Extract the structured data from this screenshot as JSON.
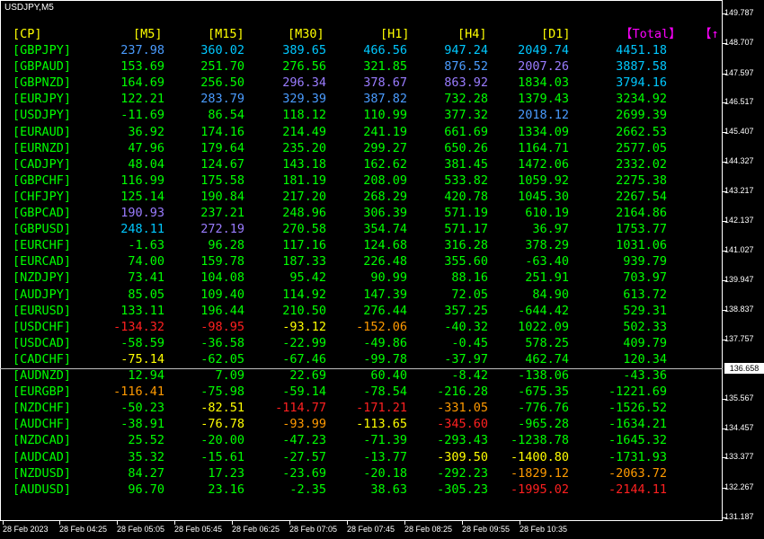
{
  "window": {
    "title": "USDJPY,M5"
  },
  "colors": {
    "pair": "#00ff00",
    "header": "#ffff00",
    "total_header": "#ff00ff",
    "c": "#00c8ff",
    "b": "#4a9cff",
    "m": "#9a7cff",
    "g": "#00ff00",
    "y": "#ffff00",
    "o": "#ff9a00",
    "r": "#ff2020"
  },
  "table": {
    "headers": [
      "[CP]",
      "[M5]",
      "[M15]",
      "[M30]",
      "[H1]",
      "[H4]",
      "[D1]",
      "【Total】",
      "【↑"
    ],
    "rows": [
      {
        "pair": "[GBPJPY]",
        "vals": [
          "237.98",
          "360.02",
          "389.65",
          "466.56",
          "947.24",
          "2049.74",
          "4451.18"
        ],
        "cols": [
          "b",
          "c",
          "c",
          "c",
          "c",
          "c",
          "c"
        ]
      },
      {
        "pair": "[GBPAUD]",
        "vals": [
          "153.69",
          "251.70",
          "276.56",
          "321.85",
          "876.52",
          "2007.26",
          "3887.58"
        ],
        "cols": [
          "g",
          "g",
          "g",
          "g",
          "b",
          "m",
          "c"
        ]
      },
      {
        "pair": "[GBPNZD]",
        "vals": [
          "164.69",
          "256.50",
          "296.34",
          "378.67",
          "863.92",
          "1834.03",
          "3794.16"
        ],
        "cols": [
          "g",
          "g",
          "m",
          "m",
          "m",
          "g",
          "c"
        ]
      },
      {
        "pair": "[EURJPY]",
        "vals": [
          "122.21",
          "283.79",
          "329.39",
          "387.82",
          "732.28",
          "1379.43",
          "3234.92"
        ],
        "cols": [
          "g",
          "b",
          "b",
          "b",
          "g",
          "g",
          "g"
        ]
      },
      {
        "pair": "[USDJPY]",
        "vals": [
          "-11.69",
          "86.54",
          "118.12",
          "110.99",
          "377.32",
          "2018.12",
          "2699.39"
        ],
        "cols": [
          "g",
          "g",
          "g",
          "g",
          "g",
          "b",
          "g"
        ]
      },
      {
        "pair": "[EURAUD]",
        "vals": [
          "36.92",
          "174.16",
          "214.49",
          "241.19",
          "661.69",
          "1334.09",
          "2662.53"
        ],
        "cols": [
          "g",
          "g",
          "g",
          "g",
          "g",
          "g",
          "g"
        ]
      },
      {
        "pair": "[EURNZD]",
        "vals": [
          "47.96",
          "179.64",
          "235.20",
          "299.27",
          "650.26",
          "1164.71",
          "2577.05"
        ],
        "cols": [
          "g",
          "g",
          "g",
          "g",
          "g",
          "g",
          "g"
        ]
      },
      {
        "pair": "[CADJPY]",
        "vals": [
          "48.04",
          "124.67",
          "143.18",
          "162.62",
          "381.45",
          "1472.06",
          "2332.02"
        ],
        "cols": [
          "g",
          "g",
          "g",
          "g",
          "g",
          "g",
          "g"
        ]
      },
      {
        "pair": "[GBPCHF]",
        "vals": [
          "116.99",
          "175.58",
          "181.19",
          "208.09",
          "533.82",
          "1059.92",
          "2275.38"
        ],
        "cols": [
          "g",
          "g",
          "g",
          "g",
          "g",
          "g",
          "g"
        ]
      },
      {
        "pair": "[CHFJPY]",
        "vals": [
          "125.14",
          "190.84",
          "217.20",
          "268.29",
          "420.78",
          "1045.30",
          "2267.54"
        ],
        "cols": [
          "g",
          "g",
          "g",
          "g",
          "g",
          "g",
          "g"
        ]
      },
      {
        "pair": "[GBPCAD]",
        "vals": [
          "190.93",
          "237.21",
          "248.96",
          "306.39",
          "571.19",
          "610.19",
          "2164.86"
        ],
        "cols": [
          "m",
          "g",
          "g",
          "g",
          "g",
          "g",
          "g"
        ]
      },
      {
        "pair": "[GBPUSD]",
        "vals": [
          "248.11",
          "272.19",
          "270.58",
          "354.74",
          "571.17",
          "36.97",
          "1753.77"
        ],
        "cols": [
          "c",
          "m",
          "g",
          "g",
          "g",
          "g",
          "g"
        ]
      },
      {
        "pair": "[EURCHF]",
        "vals": [
          "-1.63",
          "96.28",
          "117.16",
          "124.68",
          "316.28",
          "378.29",
          "1031.06"
        ],
        "cols": [
          "g",
          "g",
          "g",
          "g",
          "g",
          "g",
          "g"
        ]
      },
      {
        "pair": "[EURCAD]",
        "vals": [
          "74.00",
          "159.78",
          "187.33",
          "226.48",
          "355.60",
          "-63.40",
          "939.79"
        ],
        "cols": [
          "g",
          "g",
          "g",
          "g",
          "g",
          "g",
          "g"
        ]
      },
      {
        "pair": "[NZDJPY]",
        "vals": [
          "73.41",
          "104.08",
          "95.42",
          "90.99",
          "88.16",
          "251.91",
          "703.97"
        ],
        "cols": [
          "g",
          "g",
          "g",
          "g",
          "g",
          "g",
          "g"
        ]
      },
      {
        "pair": "[AUDJPY]",
        "vals": [
          "85.05",
          "109.40",
          "114.92",
          "147.39",
          "72.05",
          "84.90",
          "613.72"
        ],
        "cols": [
          "g",
          "g",
          "g",
          "g",
          "g",
          "g",
          "g"
        ]
      },
      {
        "pair": "[EURUSD]",
        "vals": [
          "133.11",
          "196.44",
          "210.50",
          "276.44",
          "357.25",
          "-644.42",
          "529.31"
        ],
        "cols": [
          "g",
          "g",
          "g",
          "g",
          "g",
          "g",
          "g"
        ]
      },
      {
        "pair": "[USDCHF]",
        "vals": [
          "-134.32",
          "-98.95",
          "-93.12",
          "-152.06",
          "-40.32",
          "1022.09",
          "502.33"
        ],
        "cols": [
          "r",
          "r",
          "y",
          "o",
          "g",
          "g",
          "g"
        ]
      },
      {
        "pair": "[USDCAD]",
        "vals": [
          "-58.59",
          "-36.58",
          "-22.99",
          "-49.86",
          "-0.45",
          "578.25",
          "409.79"
        ],
        "cols": [
          "g",
          "g",
          "g",
          "g",
          "g",
          "g",
          "g"
        ]
      },
      {
        "pair": "[CADCHF]",
        "vals": [
          "-75.14",
          "-62.05",
          "-67.46",
          "-99.78",
          "-37.97",
          "462.74",
          "120.34"
        ],
        "cols": [
          "y",
          "g",
          "g",
          "g",
          "g",
          "g",
          "g"
        ]
      },
      {
        "pair": "[AUDNZD]",
        "vals": [
          "12.94",
          "7.09",
          "22.69",
          "60.40",
          "-8.42",
          "-138.06",
          "-43.36"
        ],
        "cols": [
          "g",
          "g",
          "g",
          "g",
          "g",
          "g",
          "g"
        ]
      },
      {
        "pair": "[EURGBP]",
        "vals": [
          "-116.41",
          "-75.98",
          "-59.14",
          "-78.54",
          "-216.28",
          "-675.35",
          "-1221.69"
        ],
        "cols": [
          "o",
          "g",
          "g",
          "g",
          "g",
          "g",
          "g"
        ]
      },
      {
        "pair": "[NZDCHF]",
        "vals": [
          "-50.23",
          "-82.51",
          "-114.77",
          "-171.21",
          "-331.05",
          "-776.76",
          "-1526.52"
        ],
        "cols": [
          "g",
          "y",
          "r",
          "r",
          "o",
          "g",
          "g"
        ]
      },
      {
        "pair": "[AUDCHF]",
        "vals": [
          "-38.91",
          "-76.78",
          "-93.99",
          "-113.65",
          "-345.60",
          "-965.28",
          "-1634.21"
        ],
        "cols": [
          "g",
          "y",
          "o",
          "y",
          "r",
          "g",
          "g"
        ]
      },
      {
        "pair": "[NZDCAD]",
        "vals": [
          "25.52",
          "-20.00",
          "-47.23",
          "-71.39",
          "-293.43",
          "-1238.78",
          "-1645.32"
        ],
        "cols": [
          "g",
          "g",
          "g",
          "g",
          "g",
          "g",
          "g"
        ]
      },
      {
        "pair": "[AUDCAD]",
        "vals": [
          "35.32",
          "-15.61",
          "-27.57",
          "-13.77",
          "-309.50",
          "-1400.80",
          "-1731.93"
        ],
        "cols": [
          "g",
          "g",
          "g",
          "g",
          "y",
          "y",
          "g"
        ]
      },
      {
        "pair": "[NZDUSD]",
        "vals": [
          "84.27",
          "17.23",
          "-23.69",
          "-20.18",
          "-292.23",
          "-1829.12",
          "-2063.72"
        ],
        "cols": [
          "g",
          "g",
          "g",
          "g",
          "g",
          "o",
          "o"
        ]
      },
      {
        "pair": "[AUDUSD]",
        "vals": [
          "96.70",
          "23.16",
          "-2.35",
          "38.63",
          "-305.23",
          "-1995.02",
          "-2144.11"
        ],
        "cols": [
          "g",
          "g",
          "g",
          "g",
          "g",
          "r",
          "r"
        ]
      }
    ]
  },
  "price_axis": {
    "labels": [
      "149.787",
      "148.707",
      "147.597",
      "146.517",
      "145.407",
      "144.327",
      "143.217",
      "142.137",
      "141.027",
      "139.947",
      "138.837",
      "137.757",
      "135.567",
      "134.457",
      "133.377",
      "132.267",
      "131.187"
    ],
    "current_price": "136.658"
  },
  "time_axis": {
    "labels": [
      "28 Feb 2023",
      "28 Feb 04:25",
      "28 Feb 05:05",
      "28 Feb 05:45",
      "28 Feb 06:25",
      "28 Feb 07:05",
      "28 Feb 07:45",
      "28 Feb 08:25",
      "28 Feb 09:55",
      "28 Feb 10:35"
    ]
  }
}
